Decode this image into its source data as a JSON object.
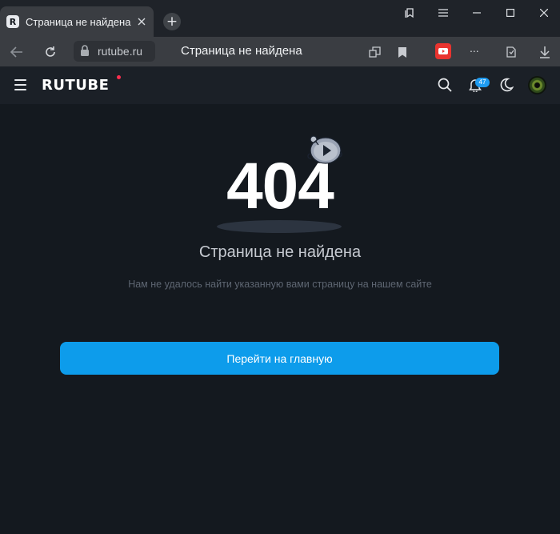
{
  "browser": {
    "tab": {
      "favicon_letter": "R",
      "title": "Страница не найдена"
    },
    "address": {
      "url": "rutube.ru",
      "page_title": "Страница не найдена",
      "more_label": "..."
    }
  },
  "site": {
    "logo": "RUTUBE",
    "notifications_count": "47"
  },
  "error": {
    "code": "404",
    "title": "Страница не найдена",
    "subtitle": "Нам не удалось найти указанную вами страницу на нашем сайте",
    "home_button": "Перейти на главную"
  },
  "colors": {
    "background": "#14191f",
    "accent": "#0d9ceb",
    "logo_dot": "#ff2e4f",
    "badge": "#1e9bf0"
  }
}
